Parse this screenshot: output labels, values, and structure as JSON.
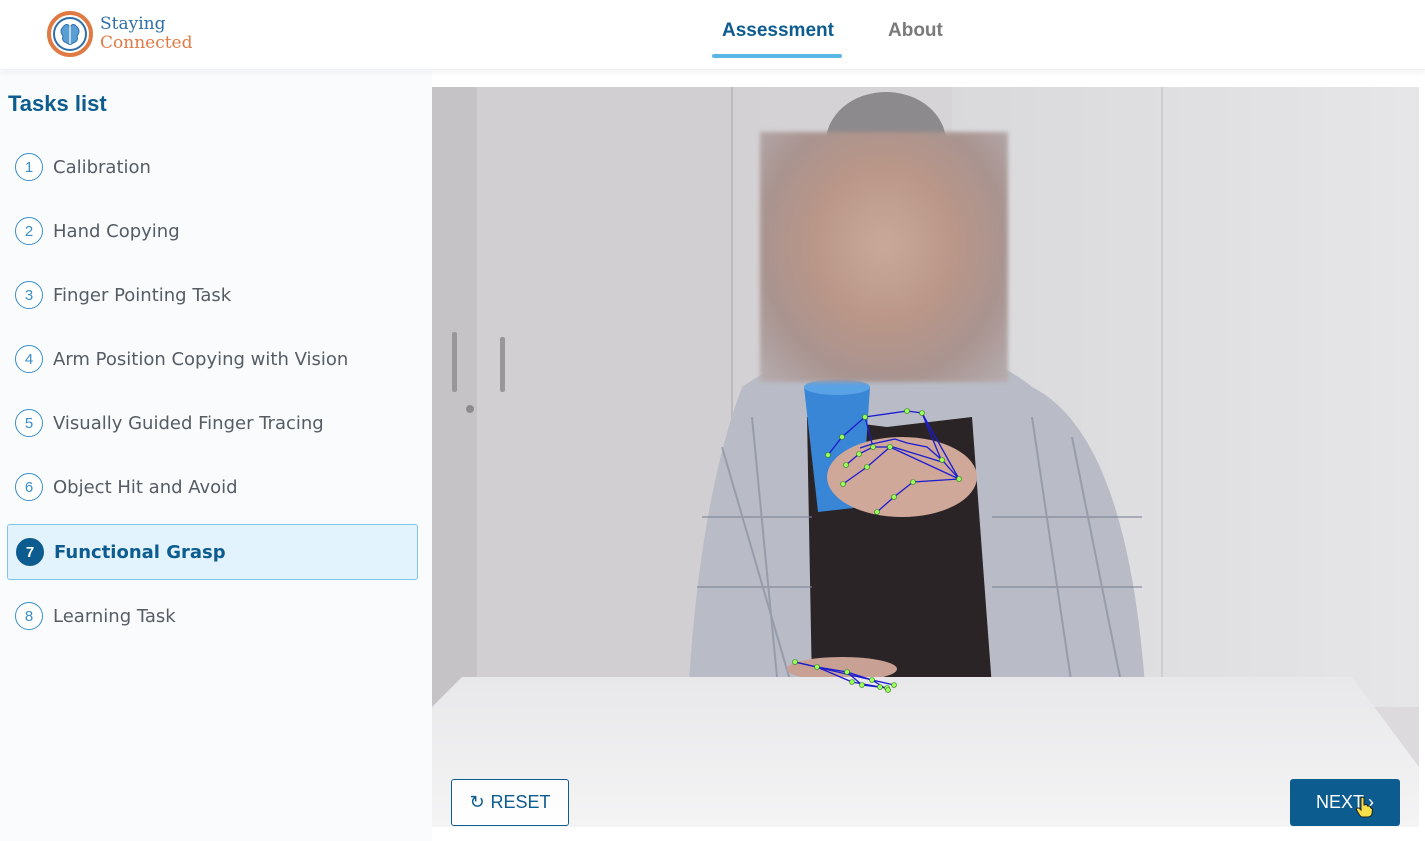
{
  "app": {
    "logo_line1": "Staying",
    "logo_line2": "Connected",
    "brand_blue": "#2f6fa8",
    "brand_orange": "#e07a45"
  },
  "nav": {
    "tabs": [
      {
        "label": "Assessment",
        "active": true
      },
      {
        "label": "About",
        "active": false
      }
    ]
  },
  "sidebar": {
    "title": "Tasks list",
    "tasks": [
      {
        "num": "1",
        "label": "Calibration"
      },
      {
        "num": "2",
        "label": "Hand Copying"
      },
      {
        "num": "3",
        "label": "Finger Pointing Task"
      },
      {
        "num": "4",
        "label": "Arm Position Copying with Vision"
      },
      {
        "num": "5",
        "label": "Visually Guided Finger Tracing"
      },
      {
        "num": "6",
        "label": "Object Hit and Avoid"
      },
      {
        "num": "7",
        "label": "Functional Grasp",
        "active": true
      },
      {
        "num": "8",
        "label": "Learning Task"
      }
    ]
  },
  "video": {
    "overlay": "hand-landmark-skeleton",
    "face": "blurred"
  },
  "controls": {
    "reset_label": "RESET",
    "reset_icon": "refresh-icon",
    "next_label": "NEXT",
    "next_icon": "chevron-right-icon"
  },
  "colors": {
    "primary": "#0d5c8f",
    "accent": "#5bb8e6",
    "active_bg": "#e3f3fd"
  }
}
